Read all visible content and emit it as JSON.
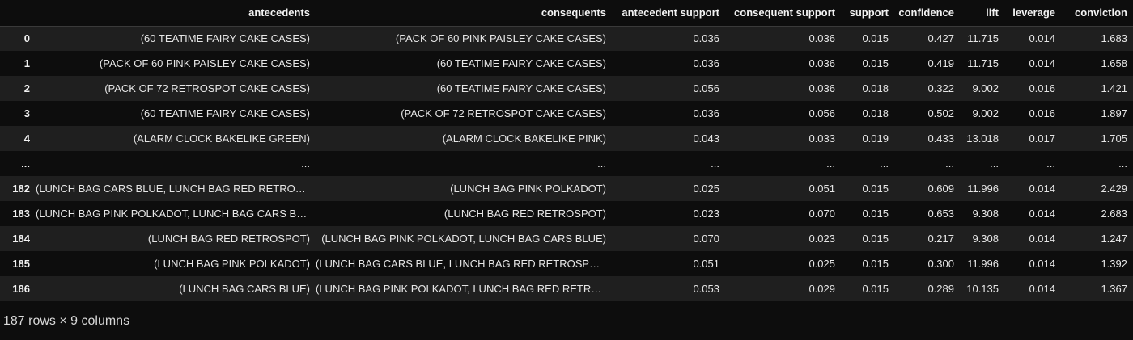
{
  "table": {
    "headers": [
      "",
      "antecedents",
      "consequents",
      "antecedent support",
      "consequent support",
      "support",
      "confidence",
      "lift",
      "leverage",
      "conviction"
    ],
    "rows": [
      [
        "0",
        "(60 TEATIME FAIRY CAKE CASES)",
        "(PACK OF 60 PINK PAISLEY CAKE CASES)",
        "0.036",
        "0.036",
        "0.015",
        "0.427",
        "11.715",
        "0.014",
        "1.683"
      ],
      [
        "1",
        "(PACK OF 60 PINK PAISLEY CAKE CASES)",
        "(60 TEATIME FAIRY CAKE CASES)",
        "0.036",
        "0.036",
        "0.015",
        "0.419",
        "11.715",
        "0.014",
        "1.658"
      ],
      [
        "2",
        "(PACK OF 72 RETROSPOT CAKE CASES)",
        "(60 TEATIME FAIRY CAKE CASES)",
        "0.056",
        "0.036",
        "0.018",
        "0.322",
        "9.002",
        "0.016",
        "1.421"
      ],
      [
        "3",
        "(60 TEATIME FAIRY CAKE CASES)",
        "(PACK OF 72 RETROSPOT CAKE CASES)",
        "0.036",
        "0.056",
        "0.018",
        "0.502",
        "9.002",
        "0.016",
        "1.897"
      ],
      [
        "4",
        "(ALARM CLOCK BAKELIKE GREEN)",
        "(ALARM CLOCK BAKELIKE PINK)",
        "0.043",
        "0.033",
        "0.019",
        "0.433",
        "13.018",
        "0.017",
        "1.705"
      ],
      [
        "...",
        "...",
        "...",
        "...",
        "...",
        "...",
        "...",
        "...",
        "...",
        "..."
      ],
      [
        "182",
        "(LUNCH BAG CARS BLUE, LUNCH BAG RED RETROSPOT)",
        "(LUNCH BAG PINK POLKADOT)",
        "0.025",
        "0.051",
        "0.015",
        "0.609",
        "11.996",
        "0.014",
        "2.429"
      ],
      [
        "183",
        "(LUNCH BAG PINK POLKADOT, LUNCH BAG CARS BLUE)",
        "(LUNCH BAG RED RETROSPOT)",
        "0.023",
        "0.070",
        "0.015",
        "0.653",
        "9.308",
        "0.014",
        "2.683"
      ],
      [
        "184",
        "(LUNCH BAG RED RETROSPOT)",
        "(LUNCH BAG PINK POLKADOT, LUNCH BAG CARS BLUE)",
        "0.070",
        "0.023",
        "0.015",
        "0.217",
        "9.308",
        "0.014",
        "1.247"
      ],
      [
        "185",
        "(LUNCH BAG PINK POLKADOT)",
        "(LUNCH BAG CARS BLUE, LUNCH BAG RED RETROSPOT)",
        "0.051",
        "0.025",
        "0.015",
        "0.300",
        "11.996",
        "0.014",
        "1.392"
      ],
      [
        "186",
        "(LUNCH BAG CARS BLUE)",
        "(LUNCH BAG PINK POLKADOT, LUNCH BAG RED RETROS...",
        "0.053",
        "0.029",
        "0.015",
        "0.289",
        "10.135",
        "0.014",
        "1.367"
      ]
    ]
  },
  "footer": {
    "text": "187 rows × 9 columns"
  },
  "colors": {
    "background": "#0d0d0d",
    "stripe": "#1f1f1f",
    "text": "#e6e6e6"
  }
}
